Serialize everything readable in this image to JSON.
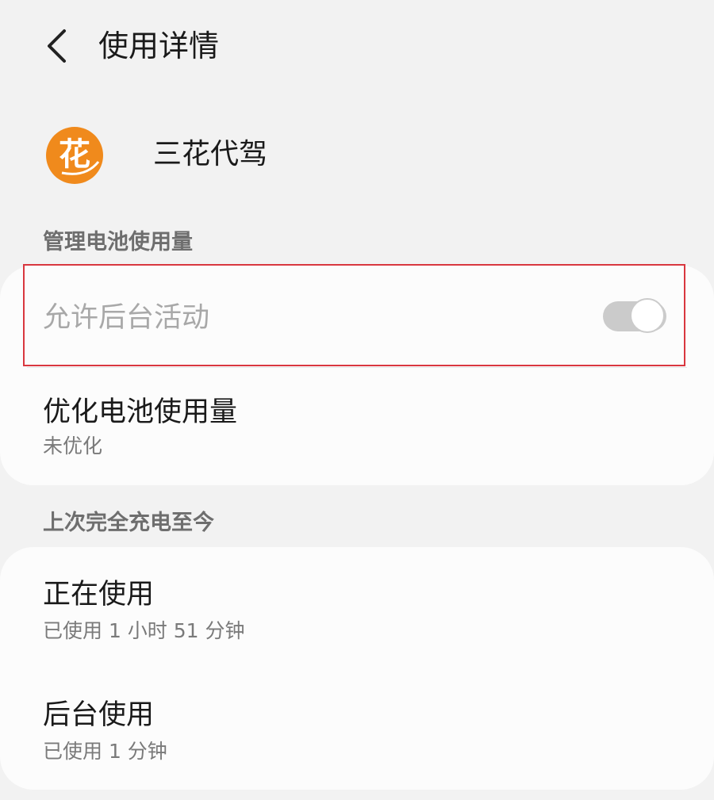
{
  "header": {
    "back_icon": "chevron-left-icon",
    "title": "使用详情"
  },
  "app": {
    "icon": "flower-logo-icon",
    "icon_glyph": "花",
    "name": "三花代驾",
    "icon_color": "#f08a1c"
  },
  "battery_section": {
    "title": "管理电池使用量",
    "items": [
      {
        "label": "允许后台活动",
        "toggle_state": "on",
        "enabled": false
      },
      {
        "label": "优化电池使用量",
        "sub": "未优化"
      }
    ]
  },
  "usage_section": {
    "title": "上次完全充电至今",
    "items": [
      {
        "label": "正在使用",
        "sub": "已使用 1 小时 51 分钟"
      },
      {
        "label": "后台使用",
        "sub": "已使用 1 分钟"
      }
    ]
  },
  "colors": {
    "highlight_border": "#d9373f",
    "background": "#f2f2f2",
    "card": "#fcfcfc"
  }
}
